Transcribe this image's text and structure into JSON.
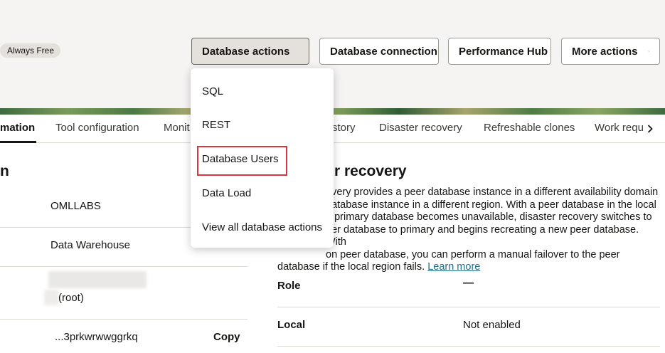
{
  "header": {
    "badge": "Always Free",
    "buttons": {
      "database_actions": "Database actions",
      "database_connection": "Database connection",
      "performance_hub": "Performance Hub",
      "more_actions": "More actions"
    }
  },
  "dropdown": {
    "items": [
      "SQL",
      "REST",
      "Database Users",
      "Data Load",
      "View all database actions"
    ],
    "highlighted": "Database Users"
  },
  "tabs": [
    "mation",
    "Tool configuration",
    "Monit",
    "story",
    "Disaster recovery",
    "Refreshable clones",
    "Work requ"
  ],
  "left_section": {
    "title": "n",
    "values": [
      "OMLLABS",
      "Data Warehouse",
      "(root)",
      "...3prkwrwwggrkq"
    ],
    "copy_label": "Copy"
  },
  "disaster_recovery": {
    "title": "r recovery",
    "desc_lines": [
      "overy provides a peer database instance in a different availability domain",
      "database instance in a different region. With a peer database in the local",
      "e primary database becomes unavailable, disaster recovery switches to",
      "eer database to primary and begins recreating a new peer database. With",
      "on peer database, you can perform a manual failover to the peer"
    ],
    "desc_last": "database if the local region fails.",
    "learn_more": "Learn more",
    "rows": [
      {
        "label": "Role",
        "value": "—"
      },
      {
        "label": "Local",
        "value": "Not enabled"
      }
    ]
  },
  "colors": {
    "highlight": "#d9363e",
    "link": "#1f6f8b"
  }
}
